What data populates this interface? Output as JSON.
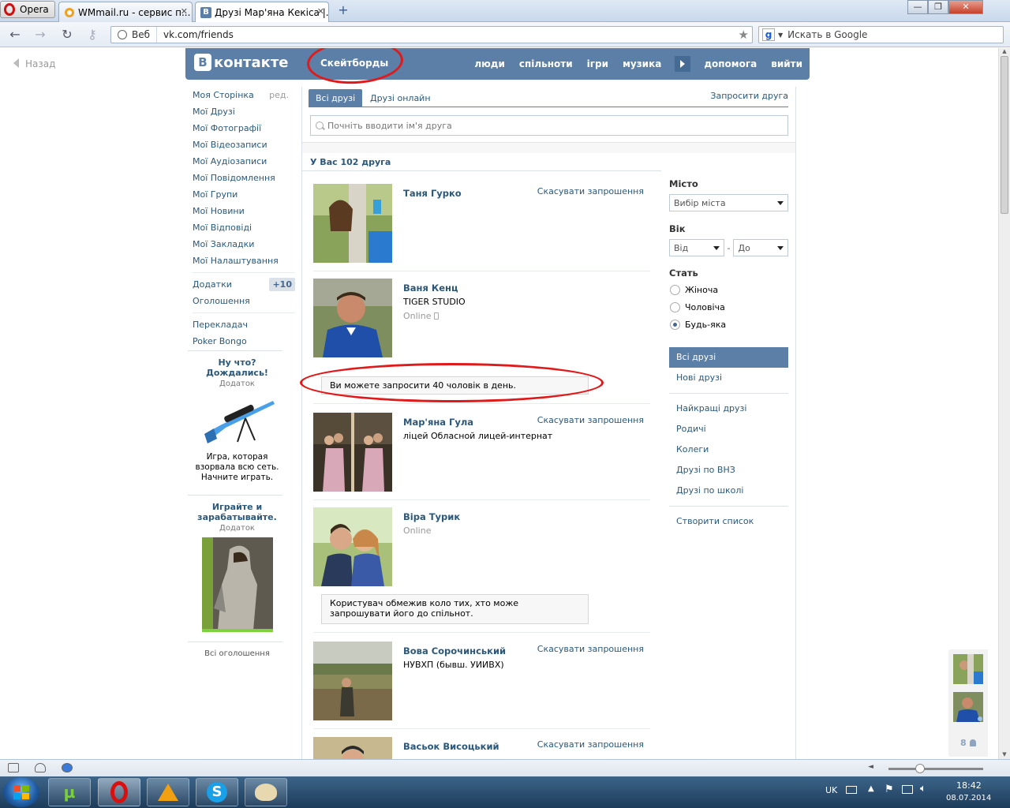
{
  "browser": {
    "menu_label": "Opera",
    "tabs": [
      {
        "title": "WMmail.ru - сервис п..."
      },
      {
        "title": "Друзі Мар'яна Кекіса |..."
      }
    ],
    "address_web_label": "Веб",
    "url": "vk.com/friends",
    "search_placeholder": "Искать в Google"
  },
  "page": {
    "back_label": "Назад",
    "header": {
      "logo_text": "контакте",
      "logo_letter": "В",
      "app_label": "Скейтборды",
      "nav": [
        "люди",
        "спільноти",
        "ігри",
        "музика",
        "допомога",
        "вийти"
      ]
    },
    "leftnav": {
      "items": [
        {
          "label": "Моя Сторінка",
          "extra": "ред."
        },
        {
          "label": "Мої Друзі"
        },
        {
          "label": "Мої Фотографії"
        },
        {
          "label": "Мої Відеозаписи"
        },
        {
          "label": "Мої Аудіозаписи"
        },
        {
          "label": "Мої Повідомлення"
        },
        {
          "label": "Мої Групи"
        },
        {
          "label": "Мої Новини"
        },
        {
          "label": "Мої Відповіді"
        },
        {
          "label": "Мої Закладки"
        },
        {
          "label": "Мої Налаштування"
        }
      ],
      "apps_label": "Додатки",
      "apps_badge": "+10",
      "ads_label": "Оголошення",
      "extra_items": [
        "Перекладач",
        "Poker Bongo"
      ]
    },
    "ads": [
      {
        "title": "Ну что? Дождались!",
        "sub": "Додаток",
        "desc": "Игра, которая взорвала всю сеть. Начните играть."
      },
      {
        "title": "Играйте и зарабатывайте.",
        "sub": "Додаток"
      }
    ],
    "all_ads_label": "Всі оголошення",
    "main": {
      "tabs": [
        "Всі друзі",
        "Друзі онлайн"
      ],
      "invite_label": "Запросити друга",
      "search_placeholder": "Почніть вводити ім'я друга",
      "count_text": "У Вас 102 друга",
      "cancel_label": "Скасувати запрошення",
      "friends": [
        {
          "name": "Таня Гурко",
          "sub": "",
          "online": "",
          "cancel": true
        },
        {
          "name": "Ваня Кенц",
          "sub": "TIGER STUDIO",
          "online": "Online",
          "cancel": false
        },
        {
          "name": "Мар'яна Гула",
          "sub": "ліцей Обласной лицей-интернат",
          "online": "",
          "cancel": true
        },
        {
          "name": "Віра Турик",
          "sub": "",
          "online": "Online",
          "cancel": false
        },
        {
          "name": "Вова Сорочинський",
          "sub": "НУВХП (бывш. УИИВХ)",
          "online": "",
          "cancel": true
        },
        {
          "name": "Васьок Висоцький",
          "sub": "",
          "online": "",
          "cancel": true
        }
      ],
      "notice_limit": "Ви можете запросити 40 чоловік в день.",
      "notice_restricted": "Користувач обмежив коло тих, хто може запрошувати його до спільнот."
    },
    "filters": {
      "city_label": "Місто",
      "city_value": "Вибір міста",
      "age_label": "Вік",
      "age_from": "Від",
      "age_sep": "-",
      "age_to": "До",
      "sex_label": "Стать",
      "sex_options": [
        "Жіноча",
        "Чоловіча",
        "Будь-яка"
      ],
      "sex_selected": "Будь-яка",
      "lists_primary": [
        "Всі друзі",
        "Нові друзі"
      ],
      "lists_secondary": [
        "Найкращі друзі",
        "Родичі",
        "Колеги",
        "Друзі по ВНЗ",
        "Друзі по школі"
      ],
      "create_list": "Створити список"
    },
    "chat_count": "8"
  },
  "taskbar": {
    "lang": "UK",
    "time": "18:42",
    "date": "08.07.2014"
  },
  "colors": {
    "vk_blue": "#5b7fa6",
    "link": "#2b587a",
    "annotation_red": "#e01a1a"
  }
}
